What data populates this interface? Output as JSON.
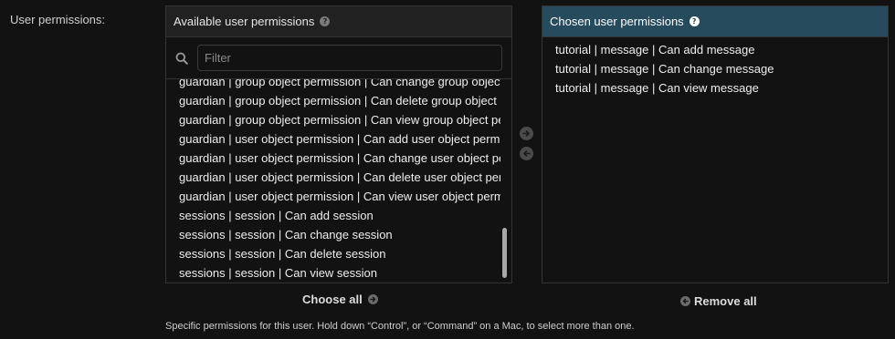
{
  "field": {
    "label": "User permissions:"
  },
  "available": {
    "title": "Available user permissions",
    "help_icon": "question-circle-icon",
    "filter_placeholder": "Filter",
    "filter_value": "",
    "items": [
      "guardian | group object permission | Can change group object permission",
      "guardian | group object permission | Can delete group object permission",
      "guardian | group object permission | Can view group object permission",
      "guardian | user object permission | Can add user object permission",
      "guardian | user object permission | Can change user object permission",
      "guardian | user object permission | Can delete user object permission",
      "guardian | user object permission | Can view user object permission",
      "sessions | session | Can add session",
      "sessions | session | Can change session",
      "sessions | session | Can delete session",
      "sessions | session | Can view session"
    ]
  },
  "chosen": {
    "title": "Chosen user permissions",
    "help_icon": "question-circle-icon",
    "items": [
      "tutorial | message | Can add message",
      "tutorial | message | Can change message",
      "tutorial | message | Can view message"
    ]
  },
  "actions": {
    "choose_all": "Choose all",
    "remove_all": "Remove all"
  },
  "help_text": "Specific permissions for this user. Hold down “Control”, or “Command” on a Mac, to select more than one.",
  "colors": {
    "chosen_header": "#264b5d",
    "background": "#121212",
    "border": "#333333"
  }
}
